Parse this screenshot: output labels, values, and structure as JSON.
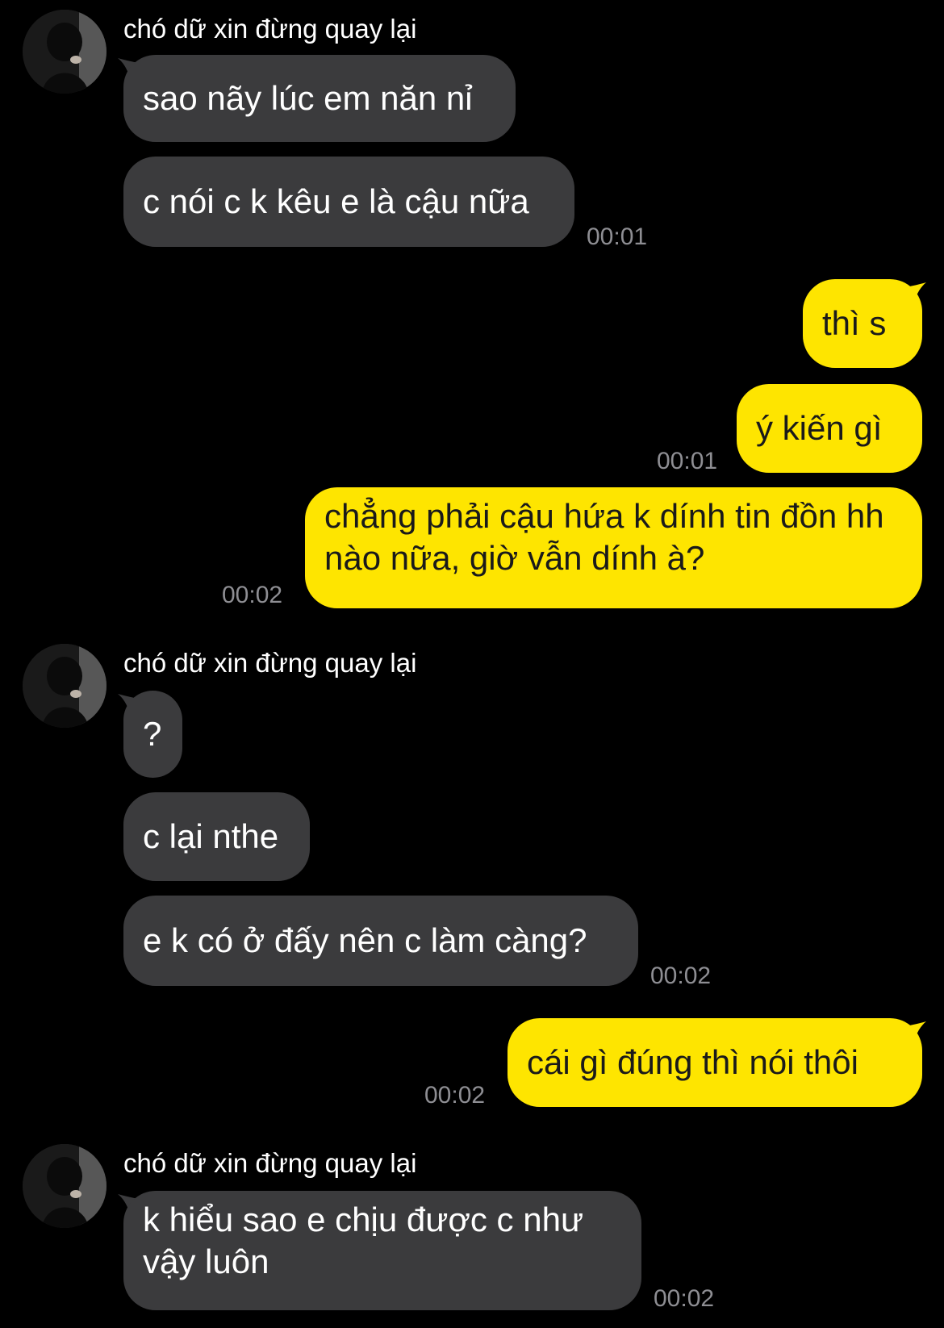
{
  "contact": {
    "name": "chó dữ xin đừng quay lại",
    "avatar_icon": "avatar-photo"
  },
  "colors": {
    "background": "#000000",
    "incoming_bubble": "#3b3b3d",
    "outgoing_bubble": "#fee500",
    "timestamp": "#8e8e93"
  },
  "messages": [
    {
      "side": "incoming",
      "text": "sao nãy lúc em năn nỉ",
      "time": ""
    },
    {
      "side": "incoming",
      "text": "c nói c k kêu e là cậu nữa",
      "time": "00:01"
    },
    {
      "side": "outgoing",
      "text": "thì s",
      "time": ""
    },
    {
      "side": "outgoing",
      "text": "ý kiến gì",
      "time": "00:01"
    },
    {
      "side": "outgoing",
      "text": "chẳng phải cậu hứa k dính tin đồn hh nào nữa, giờ vẫn dính à?",
      "time": "00:02"
    },
    {
      "side": "incoming",
      "text": "?",
      "time": ""
    },
    {
      "side": "incoming",
      "text": "c lại nthe",
      "time": ""
    },
    {
      "side": "incoming",
      "text": "e k có ở đấy nên c làm càng?",
      "time": "00:02"
    },
    {
      "side": "outgoing",
      "text": "cái gì đúng thì nói thôi",
      "time": "00:02"
    },
    {
      "side": "incoming",
      "text": "k hiểu sao e chịu được c như vậy luôn",
      "time": "00:02"
    }
  ]
}
